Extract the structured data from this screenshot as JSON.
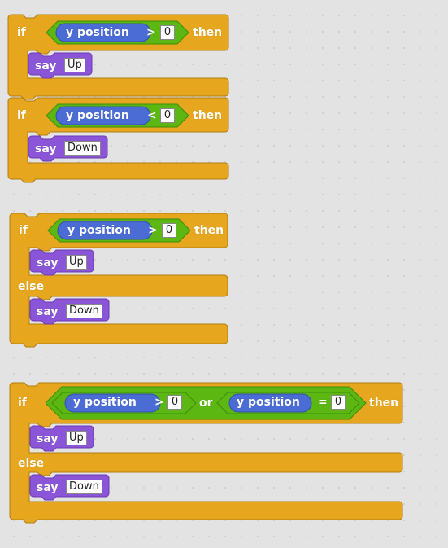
{
  "colors": {
    "control": "#e6a61e",
    "control_edge": "#b07d10",
    "operator": "#5cb712",
    "operator_edge": "#3f8c0b",
    "sensing_motion": "#4a6cd4",
    "sensing_edge": "#3150a8",
    "looks": "#8a55d7",
    "looks_edge": "#6a3bb0",
    "canvas": "#e3e3e3"
  },
  "scripts": [
    {
      "kind": "if",
      "if_label": "if",
      "then_label": "then",
      "condition": {
        "reporter": "y position",
        "operator": ">",
        "value": "0"
      },
      "body": {
        "say_label": "say",
        "message": "Up"
      }
    },
    {
      "kind": "if",
      "if_label": "if",
      "then_label": "then",
      "condition": {
        "reporter": "y position",
        "operator": "<",
        "value": "0"
      },
      "body": {
        "say_label": "say",
        "message": "Down"
      }
    },
    {
      "kind": "if-else",
      "if_label": "if",
      "then_label": "then",
      "else_label": "else",
      "condition": {
        "reporter": "y position",
        "operator": ">",
        "value": "0"
      },
      "body": {
        "say_label": "say",
        "message": "Up"
      },
      "else_body": {
        "say_label": "say",
        "message": "Down"
      }
    },
    {
      "kind": "if-else",
      "if_label": "if",
      "then_label": "then",
      "else_label": "else",
      "condition": {
        "left": {
          "reporter": "y position",
          "operator": ">",
          "value": "0"
        },
        "joiner": "or",
        "right": {
          "reporter": "y position",
          "operator": "=",
          "value": "0"
        }
      },
      "body": {
        "say_label": "say",
        "message": "Up"
      },
      "else_body": {
        "say_label": "say",
        "message": "Down"
      }
    }
  ]
}
